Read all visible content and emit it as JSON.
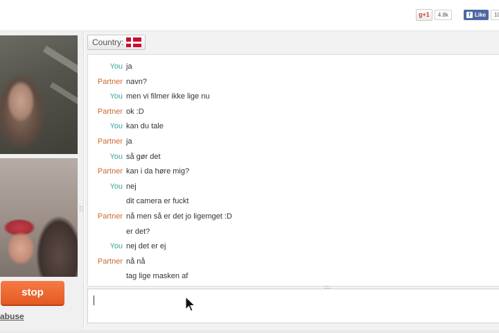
{
  "header": {
    "gplus": {
      "label": "g+1",
      "count": "4.8k"
    },
    "facebook": {
      "label": "Like",
      "count": "10"
    }
  },
  "sidebar": {
    "stop_label": "stop",
    "abuse_label": "abuse"
  },
  "country": {
    "label": "Country:",
    "flag": "denmark-flag"
  },
  "messages": [
    {
      "who": "You",
      "text": "ja"
    },
    {
      "who": "Partner",
      "text": "navn?"
    },
    {
      "who": "You",
      "text": "men vi filmer ikke lige nu"
    },
    {
      "who": "Partner",
      "text": "ok :D"
    },
    {
      "who": "You",
      "text": "kan du tale"
    },
    {
      "who": "Partner",
      "text": "ja"
    },
    {
      "who": "You",
      "text": "så gør det"
    },
    {
      "who": "Partner",
      "text": "kan i da høre mig?"
    },
    {
      "who": "You",
      "text": "nej"
    },
    {
      "who": "",
      "text": "dit camera er fuckt"
    },
    {
      "who": "Partner",
      "text": "nå men så er det jo ligemget :D"
    },
    {
      "who": "",
      "text": "er det?"
    },
    {
      "who": "You",
      "text": "nej det er ej"
    },
    {
      "who": "Partner",
      "text": "nå nå"
    },
    {
      "who": "",
      "text": "tag lige masken af"
    }
  ],
  "input": {
    "value": ""
  },
  "colors": {
    "you": "#3aa59a",
    "partner": "#d0672f",
    "stop_button": "#ef6b34",
    "facebook": "#4e69a2",
    "gplus": "#d73d32"
  }
}
